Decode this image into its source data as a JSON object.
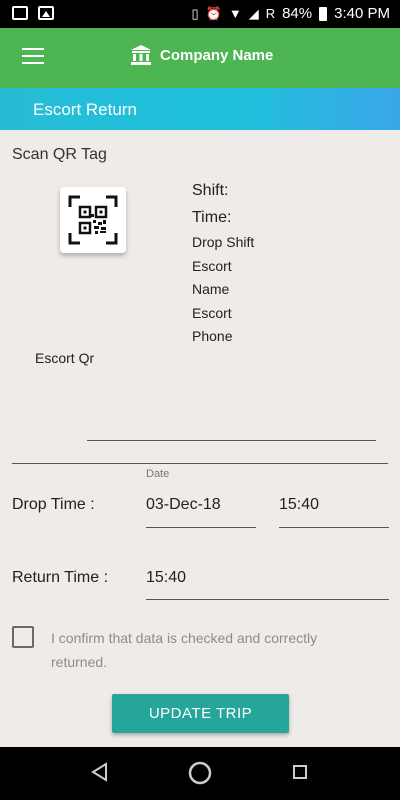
{
  "status_bar": {
    "carrier_letter": "R",
    "battery": "84%",
    "time": "3:40 PM"
  },
  "app_bar": {
    "title": "Company Name"
  },
  "sub_header": {
    "title": "Escort Return"
  },
  "scan": {
    "label": "Scan QR Tag",
    "qr_label": "Escort Qr"
  },
  "info": {
    "shift_label": "Shift:",
    "time_label": "Time:",
    "drop_shift_label": "Drop Shift",
    "escort_name_line1": "Escort",
    "escort_name_line2": "Name",
    "escort_phone_line1": "Escort",
    "escort_phone_line2": "Phone"
  },
  "drop": {
    "date_caption": "Date",
    "label": "Drop Time :",
    "date": "03-Dec-18",
    "time": "15:40"
  },
  "return": {
    "label": "Return Time :",
    "time": "15:40"
  },
  "confirm": {
    "text": "I confirm that data is checked and correctly returned.",
    "checked": false
  },
  "update_button": {
    "label": "UPDATE TRIP"
  },
  "colors": {
    "app_bar": "#4eb553",
    "sub_header": "#1fc1dc",
    "button": "#26a69a",
    "background": "#efebe8"
  }
}
